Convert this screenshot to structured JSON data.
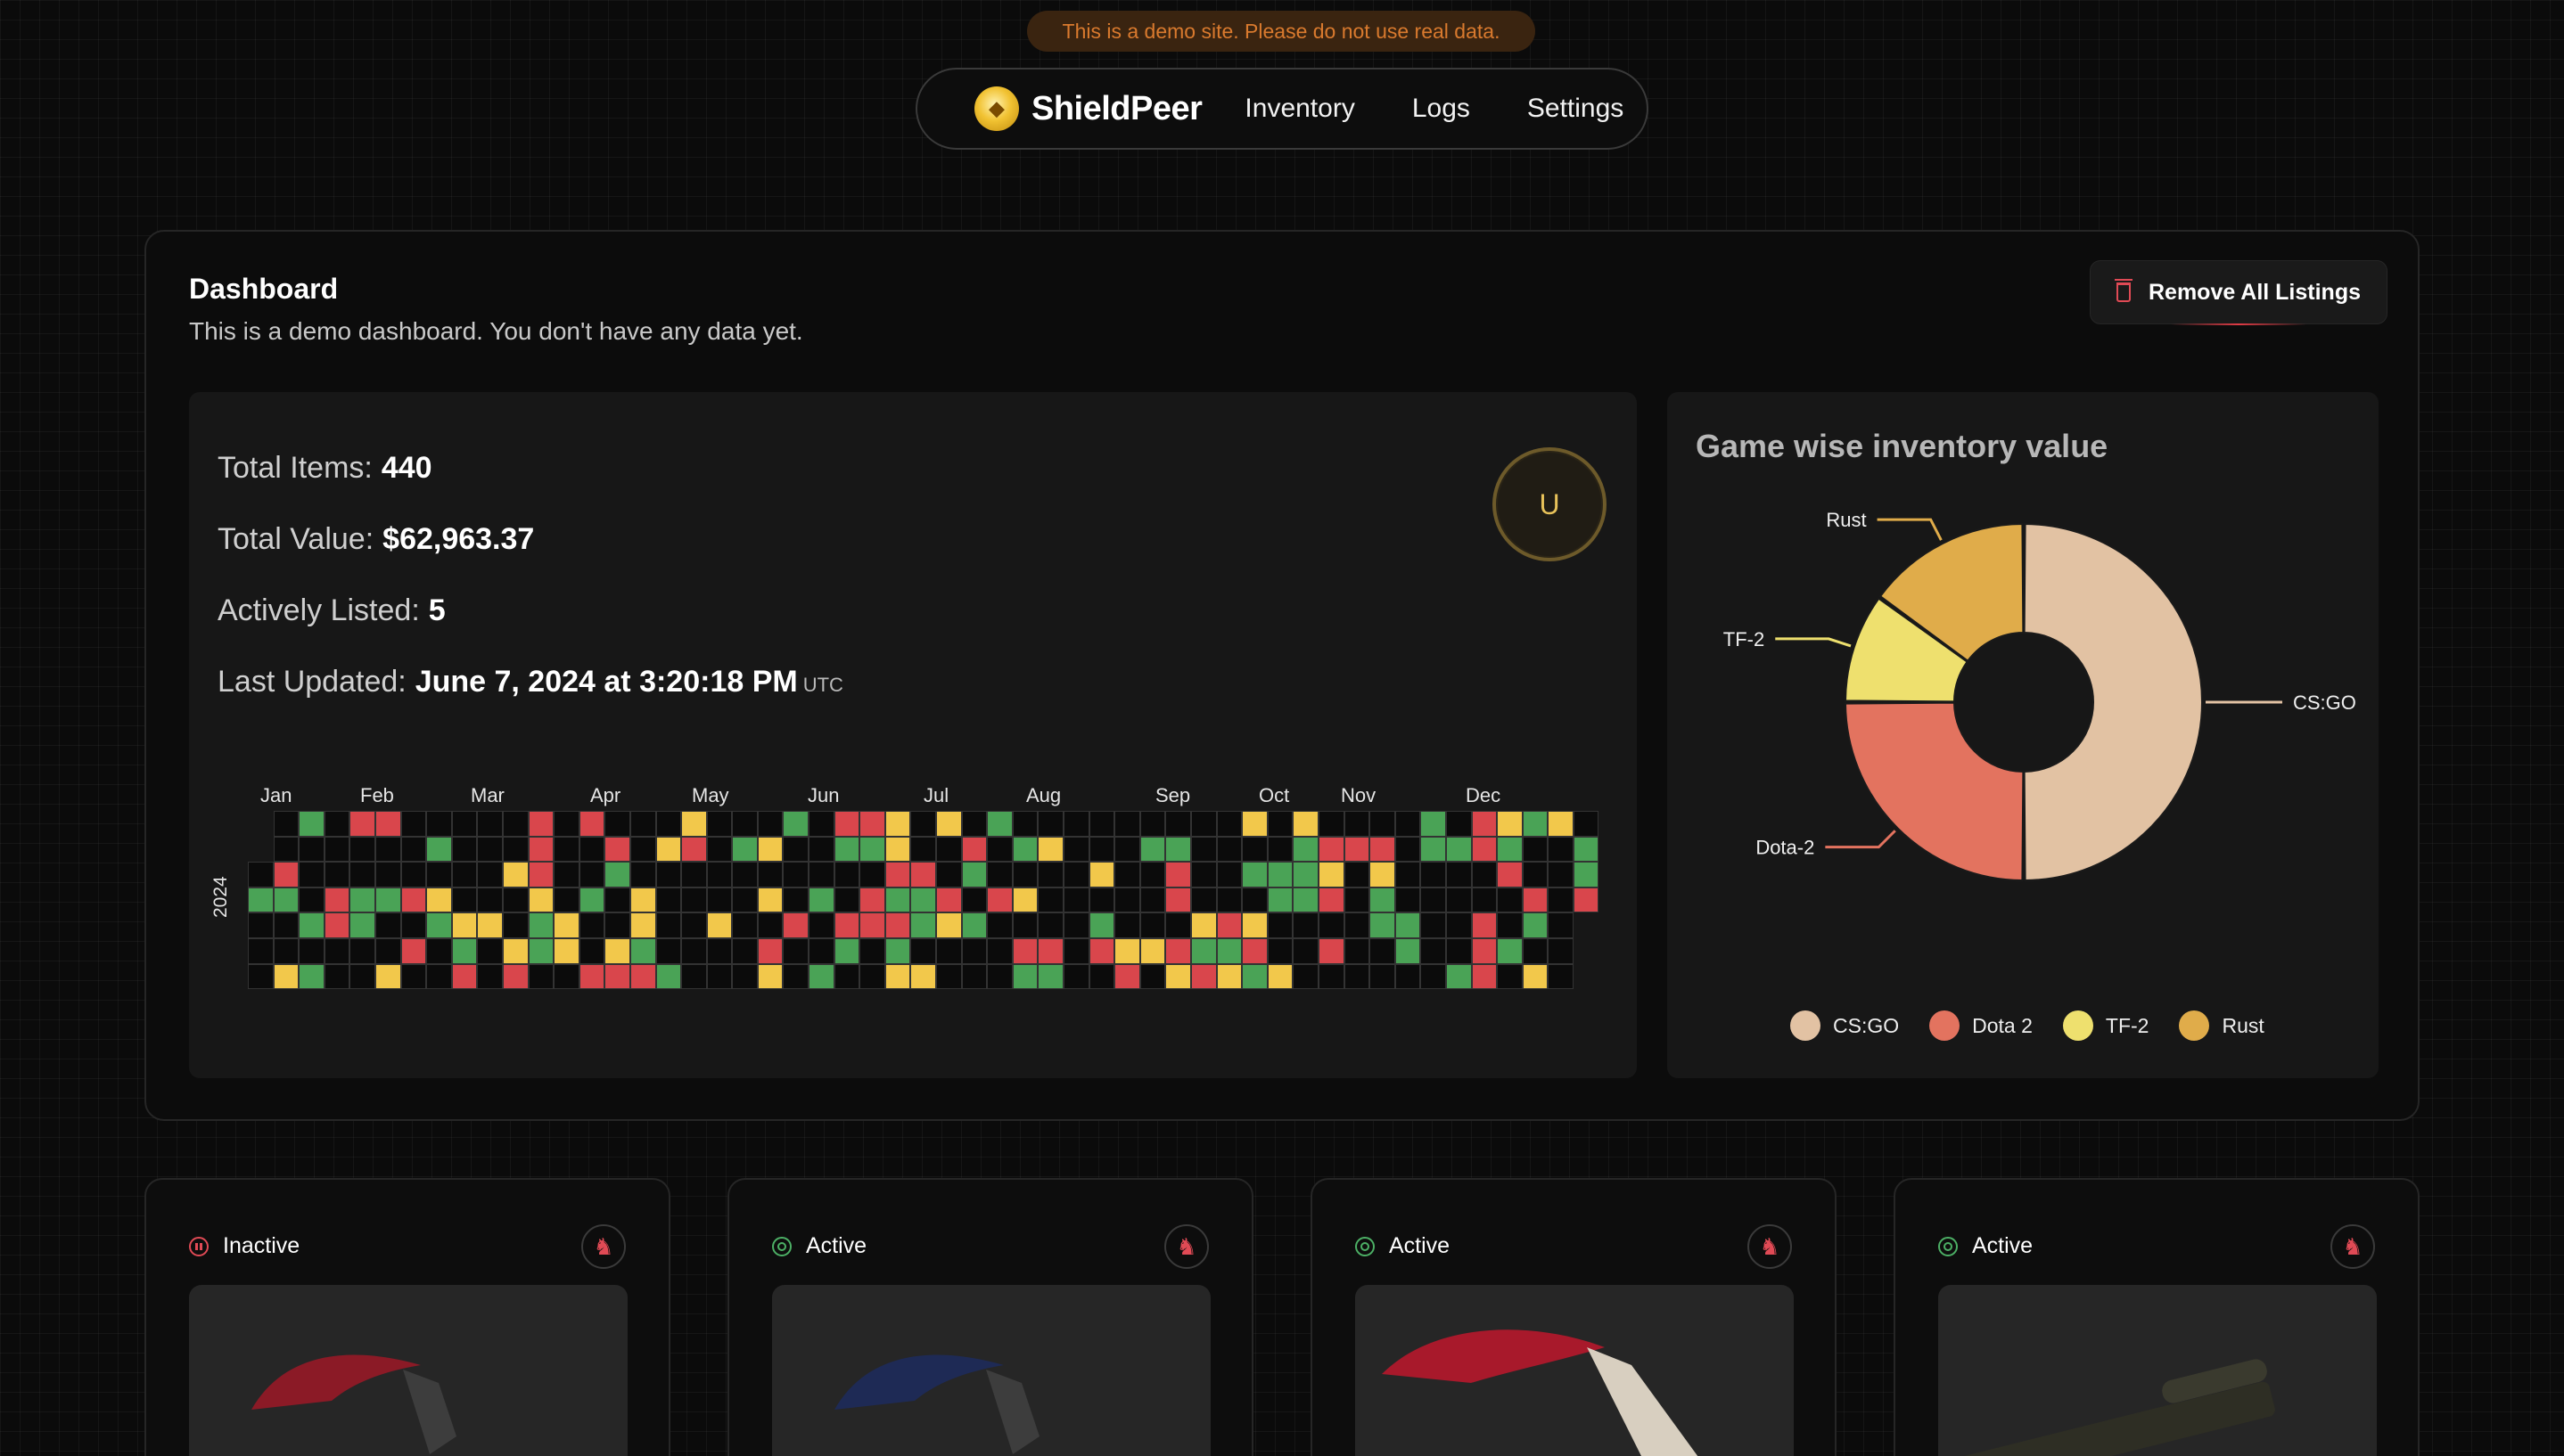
{
  "banner": "This is a demo site. Please do not use real data.",
  "nav": {
    "brand": "ShieldPeer",
    "links": [
      "Inventory",
      "Logs",
      "Settings"
    ]
  },
  "dashboard": {
    "title": "Dashboard",
    "subtitle": "This is a demo dashboard. You don't have any data yet.",
    "remove_button": "Remove All Listings",
    "stats": {
      "total_items_label": "Total Items:",
      "total_items": "440",
      "total_value_label": "Total Value:",
      "total_value": "$62,963.37",
      "actively_listed_label": "Actively Listed:",
      "actively_listed": "5",
      "last_updated_label": "Last Updated:",
      "last_updated": "June 7, 2024 at 3:20:18 PM",
      "timezone": "UTC"
    },
    "avatar_initial": "U",
    "heatmap": {
      "year": "2024",
      "months": [
        "Jan",
        "Feb",
        "Mar",
        "Apr",
        "May",
        "Jun",
        "Jul",
        "Aug",
        "Sep",
        "Oct",
        "Nov",
        "Dec"
      ],
      "colors": {
        "green": "#4aa356",
        "yellow": "#f2c84b",
        "red": "#d9464c"
      }
    }
  },
  "chart_data": {
    "type": "pie",
    "title": "Game wise inventory value",
    "categories": [
      "CS:GO",
      "Dota 2",
      "TF-2",
      "Rust"
    ],
    "slice_labels": [
      "CS:GO",
      "Dota-2",
      "TF-2",
      "Rust"
    ],
    "values": [
      50,
      25,
      10,
      15
    ],
    "colors": [
      "#e2c2a3",
      "#e3735f",
      "#eee06e",
      "#e0ac4a"
    ],
    "legend_position": "bottom"
  },
  "cards": [
    {
      "status": "Inactive",
      "state": "inactive"
    },
    {
      "status": "Active",
      "state": "active"
    },
    {
      "status": "Active",
      "state": "active"
    },
    {
      "status": "Active",
      "state": "active"
    }
  ]
}
